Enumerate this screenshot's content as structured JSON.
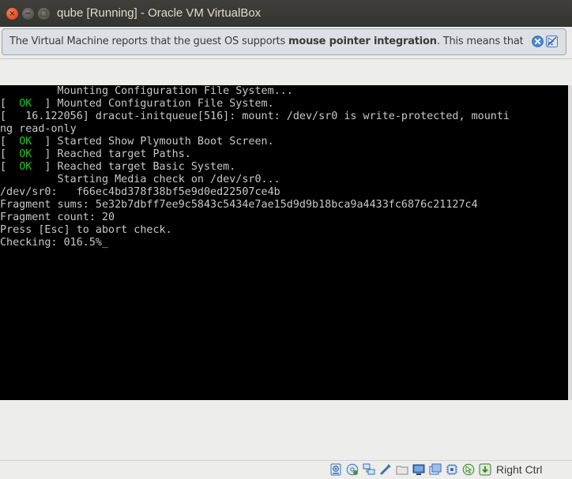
{
  "window": {
    "title": "qube [Running] - Oracle VM VirtualBox",
    "buttons": {
      "close": "×",
      "minimize": "−",
      "maximize": "□"
    }
  },
  "notification": {
    "text_before": "The Virtual Machine reports that the guest OS supports ",
    "text_bold": "mouse pointer integration",
    "text_after": ". This means that you do"
  },
  "terminal": {
    "lines": [
      {
        "text": "         Mounting Configuration File System..."
      },
      {
        "prefix": "[  ",
        "ok": "OK",
        "suffix": "  ] Mounted Configuration File System."
      },
      {
        "text": "[   16.122056] dracut-initqueue[516]: mount: /dev/sr0 is write-protected, mounti"
      },
      {
        "text": "ng read-only"
      },
      {
        "prefix": "[  ",
        "ok": "OK",
        "suffix": "  ] Started Show Plymouth Boot Screen."
      },
      {
        "prefix": "[  ",
        "ok": "OK",
        "suffix": "  ] Reached target Paths."
      },
      {
        "prefix": "[  ",
        "ok": "OK",
        "suffix": "  ] Reached target Basic System."
      },
      {
        "text": "         Starting Media check on /dev/sr0..."
      },
      {
        "text": "/dev/sr0:   f66ec4bd378f38bf5e9d0ed22507ce4b"
      },
      {
        "text": "Fragment sums: 5e32b7dbff7ee9c5843c5434e7ae15d9d9b18bca9a4433fc6876c21127c4"
      },
      {
        "text": "Fragment count: 20"
      },
      {
        "text": "Press [Esc] to abort check."
      },
      {
        "text": "Checking: 016.5%_"
      }
    ]
  },
  "statusbar": {
    "icons": [
      "hard-disk-icon",
      "optical-drive-icon",
      "network-icon",
      "usb-icon",
      "shared-folders-icon",
      "display-icon",
      "video-capture-icon",
      "mouse-integration-icon",
      "cpu-icon",
      "keyboard-capture-icon"
    ],
    "host_key": "Right Ctrl"
  },
  "colors": {
    "ok": "#22c222",
    "terminal_text": "#c8c8c8",
    "titlebar": "#3c3b37"
  }
}
